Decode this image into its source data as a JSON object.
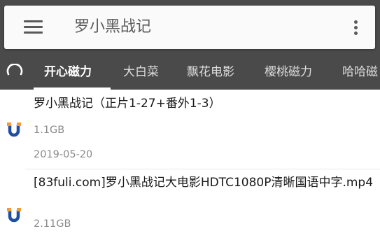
{
  "search": {
    "query": "罗小黑战记",
    "menu_icon": "hamburger-menu-icon",
    "more_icon": "more-vertical-icon"
  },
  "tabs": [
    {
      "label": "开心磁力",
      "active": true
    },
    {
      "label": "大白菜",
      "active": false
    },
    {
      "label": "飘花电影",
      "active": false
    },
    {
      "label": "樱桃磁力",
      "active": false
    },
    {
      "label": "哈哈磁",
      "active": false
    }
  ],
  "results": [
    {
      "title": "罗小黑战记（正片1-27+番外1-3）",
      "size": "1.1GB",
      "date": "2019-05-20",
      "icon": "magnet-icon"
    },
    {
      "title": "[83fuli.com]罗小黑战记大电影HDTC1080P清晰国语中字.mp4",
      "size": "2.11GB",
      "date": "",
      "icon": "magnet-icon"
    }
  ],
  "colors": {
    "toolbar": "#4a4a4a",
    "magnet_blue": "#1e4fa3",
    "magnet_orange": "#f0a02a",
    "secondary_text": "#8a8a8a"
  }
}
